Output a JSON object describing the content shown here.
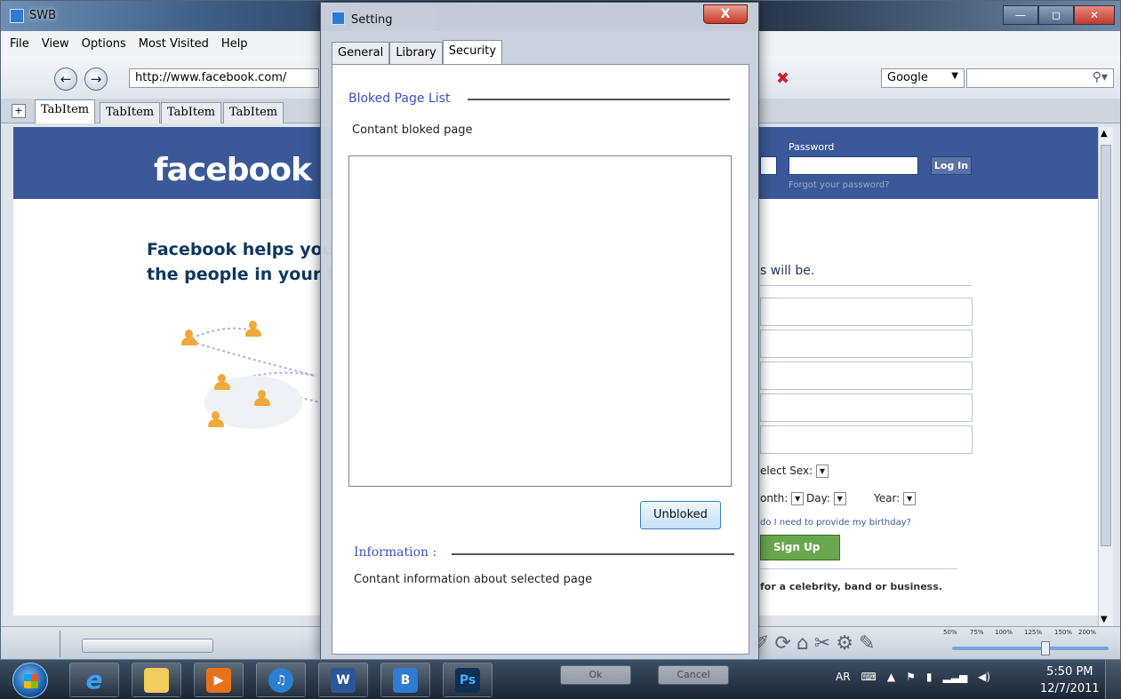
{
  "browser": {
    "title": "SWB",
    "menu": [
      "File",
      "View",
      "Options",
      "Most Visited",
      "Help"
    ],
    "url": "http://www.facebook.com/",
    "search_engine": "Google",
    "tabs": [
      "TabItem",
      "TabItem",
      "TabItem",
      "TabItem"
    ],
    "new_tab_label": "+"
  },
  "facebook": {
    "logo": "facebook",
    "password_label": "Password",
    "login_label": "Log In",
    "forgot_label": "Forgot your password?",
    "tagline_1": "Facebook helps you",
    "tagline_2": "the people in your li",
    "will_be": "s will be.",
    "select_sex": "elect Sex:",
    "month": "onth:",
    "day": "Day:",
    "year": "Year:",
    "why_birthday": "do I need to provide my birthday?",
    "signup_label": "Sign Up",
    "celebrity": "for a celebrity, band or business.",
    "brand_color": "#3b5998"
  },
  "dialog": {
    "title": "Setting",
    "close_label": "X",
    "tabs": [
      "General",
      "Library",
      "Security"
    ],
    "active_tab": "Security",
    "blocked_title": "Bloked Page List",
    "blocked_caption": "Contant bloked page",
    "unblock_label": "Unbloked",
    "info_title": "Information :",
    "info_caption": "Contant information about selected page",
    "ok_label": "Ok",
    "cancel_label": "Cancel",
    "accent_color": "#3b4fc4"
  },
  "statusbar": {
    "zoom_levels": [
      "50%",
      "75%",
      "100%",
      "125%",
      "150%",
      "200%"
    ]
  },
  "taskbar": {
    "word_label": "W",
    "ps_label": "Ps",
    "lang": "AR",
    "time": "5:50 PM",
    "date": "12/7/2011"
  }
}
